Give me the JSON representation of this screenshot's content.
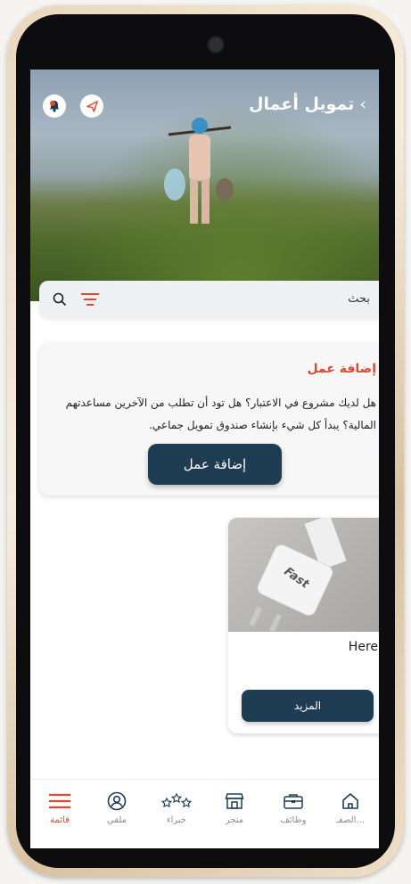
{
  "header": {
    "title": "تمويل أعمال",
    "back_glyph": "›"
  },
  "search": {
    "placeholder": "بحث"
  },
  "add_business_card": {
    "title": "إضافة عمل",
    "body": "هل لديك مشروع في الاعتبار؟ هل تود أن تطلب من الآخرين مساعدتهم المالية؟ يبدأ كل شيء بإنشاء صندوق تمويل جماعي.",
    "button_label": "إضافة عمل"
  },
  "product_card": {
    "image_text": "Fast",
    "name": "Here",
    "more_label": "المزيد"
  },
  "nav": {
    "items": [
      {
        "label": "قائمة",
        "icon": "menu-icon",
        "active": true
      },
      {
        "label": "ملفي",
        "icon": "profile-icon"
      },
      {
        "label": "خبراء",
        "icon": "stars-icon"
      },
      {
        "label": "متجر",
        "icon": "store-icon"
      },
      {
        "label": "وظائف",
        "icon": "briefcase-icon"
      },
      {
        "label": "الصفـ...",
        "icon": "home-icon"
      }
    ]
  },
  "colors": {
    "accent": "#e0492f",
    "primary": "#1f3d52"
  }
}
